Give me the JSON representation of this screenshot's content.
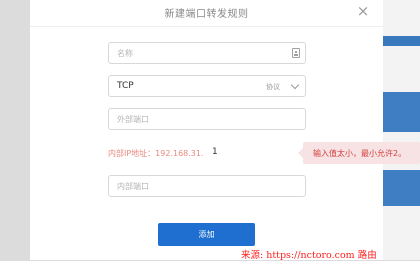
{
  "dialog": {
    "title": "新建端口转发规则",
    "close_symbol": "×"
  },
  "form": {
    "name_placeholder": "名称",
    "protocol_value": "TCP",
    "protocol_tag": "协议",
    "external_port_placeholder": "外部端口",
    "internal_ip_label": "内部IP地址：192.168.31.",
    "internal_ip_value": "1",
    "internal_port_placeholder": "内部端口",
    "add_label": "添加"
  },
  "validation": {
    "message": "输入值太小，最小允许2。"
  },
  "watermark": {
    "text": "来源: https://nctoro.com 路由"
  },
  "colors": {
    "accent": "#1e6fd0",
    "error_text": "#d43c3c",
    "error_bg": "#f7e3e3",
    "label_pink": "#e8897f"
  }
}
